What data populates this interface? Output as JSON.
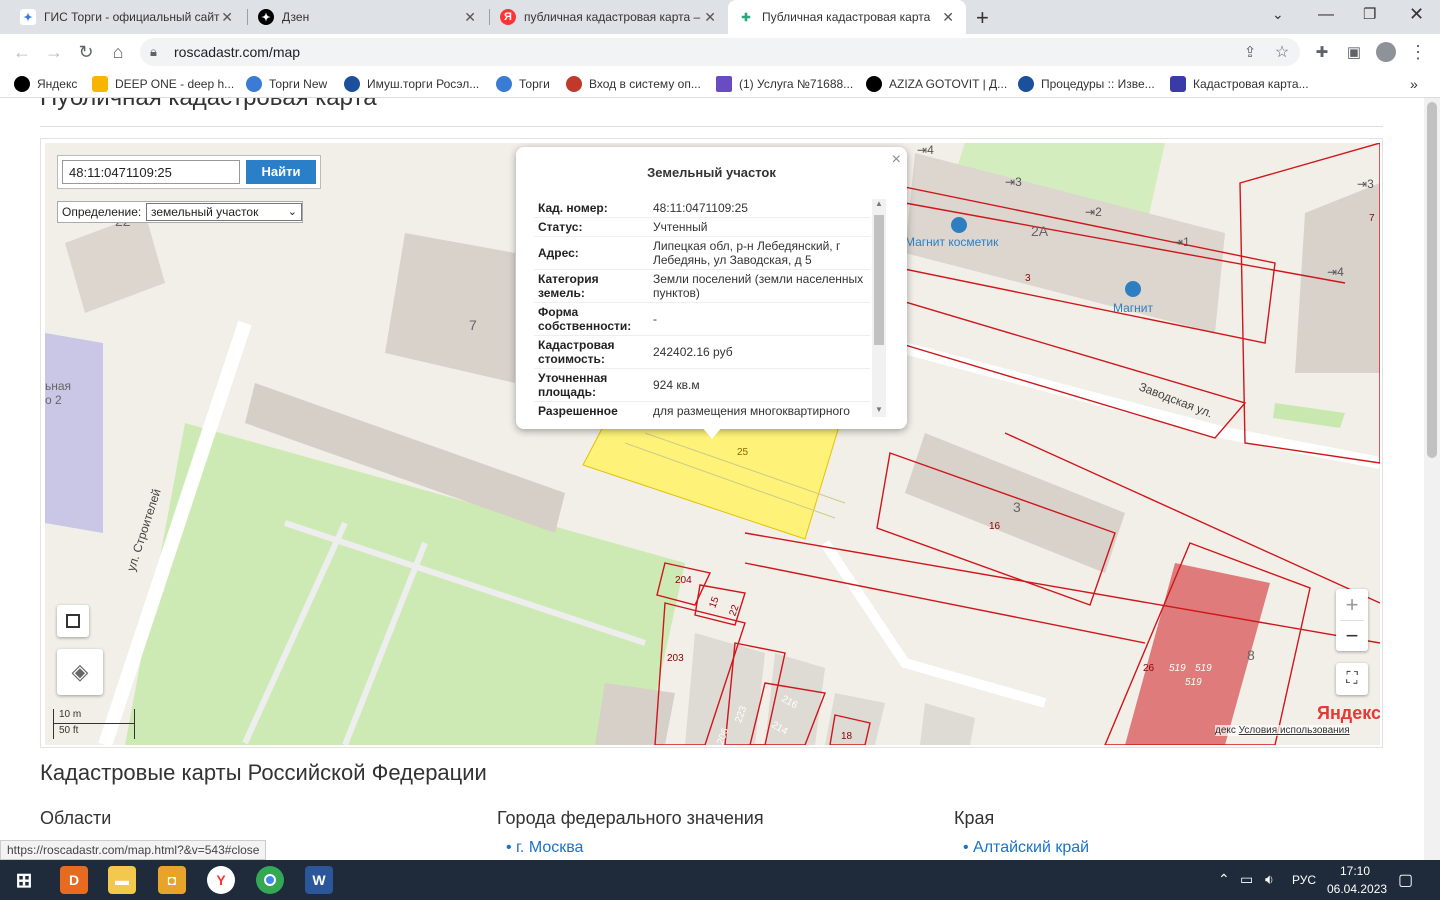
{
  "tabs": [
    {
      "label": "ГИС Торги - официальный сайт",
      "icon": "gis-torgi-icon",
      "color": "#3a7bd5"
    },
    {
      "label": "Дзен",
      "icon": "dzen-icon",
      "color": "#000000"
    },
    {
      "label": "публичная кадастровая карта –",
      "icon": "yandex-icon",
      "color": "#f33"
    },
    {
      "label": "Публичная кадастровая карта",
      "icon": "map-icon",
      "color": "#2aa876"
    }
  ],
  "url": "roscadastr.com/map",
  "bookmarks": [
    {
      "label": "Яндекс",
      "color": "#000000"
    },
    {
      "label": "DEEP ONE - deep h...",
      "color": "#f7b500"
    },
    {
      "label": "Торги New",
      "color": "#3a7bd5"
    },
    {
      "label": "Имуш.торги Росэл...",
      "color": "#1c4f9c"
    },
    {
      "label": "Торги",
      "color": "#3a7bd5"
    },
    {
      "label": "Вход в систему оп...",
      "color": "#c0392b"
    },
    {
      "label": "(1) Услуга №71688...",
      "color": "#6a4cc2"
    },
    {
      "label": "AZIZA GOTOVIT | Д...",
      "color": "#000000"
    },
    {
      "label": "Процедуры :: Изве...",
      "color": "#1c4f9c"
    },
    {
      "label": "Кадастровая карта...",
      "color": "#3a3aa8"
    }
  ],
  "page": {
    "title": "Публичная кадастровая карта",
    "search_value": "48:11:0471109:25",
    "find_label": "Найти",
    "definition_label": "Определение:",
    "definition_value": "земельный участок"
  },
  "popup": {
    "title": "Земельный участок",
    "rows": [
      {
        "k": "Кад. номер:",
        "v": "48:11:0471109:25"
      },
      {
        "k": "Статус:",
        "v": "Учтенный"
      },
      {
        "k": "Адрес:",
        "v": "Липецкая обл, р-н Лебедянский, г Лебедянь, ул Заводская, д 5"
      },
      {
        "k": "Категория земель:",
        "v": "Земли поселений (земли населенных пунктов)"
      },
      {
        "k": "Форма собственности:",
        "v": "-"
      },
      {
        "k": "Кадастровая стоимость:",
        "v": "242402.16 руб"
      },
      {
        "k": "Уточненная площадь:",
        "v": "924 кв.м"
      },
      {
        "k": "Разрешенное",
        "v": "для размещения многоквартирного"
      }
    ]
  },
  "map": {
    "labels": {
      "magnit_kosmetik": "Магнит косметик",
      "magnit": "Магнит",
      "zavodskaya": "Заводская ул.",
      "stroiteley": "ул. Строителей",
      "b2a": "2А",
      "b7": "7",
      "b3": "3",
      "b8": "8",
      "b22": "22",
      "b4": "4",
      "parcel25": "25",
      "p16": "16",
      "p204": "204",
      "p15": "15",
      "p22": "22",
      "p203": "203",
      "p26": "26",
      "p519a": "519",
      "p519b": "519",
      "p519c": "519",
      "p223": "223",
      "p216": "216",
      "p214": "214",
      "p206": "206",
      "p18": "18",
      "p3": "3",
      "p7": "7",
      "pn2": "2",
      "pn3": "3",
      "pn1": "1",
      "pn4": "4",
      "pn4b": "4",
      "pn3b": "3",
      "school": "ьная\nо 2",
      "yandex": "Яндекс",
      "terms": "Условия использования",
      "terms_prefix": "декс",
      "scale_m": "10 m",
      "scale_ft": "50 ft"
    },
    "zoom_in": "+",
    "zoom_out": "−"
  },
  "below": {
    "title": "Кадастровые карты Российской Федерации",
    "col1": "Области",
    "col2": "Города федерального значения",
    "col3": "Края",
    "link2": "г. Москва",
    "link3": "Алтайский край"
  },
  "status_url": "https://roscadastr.com/map.html?&v=543#close",
  "tray": {
    "lang": "РУС",
    "time": "17:10",
    "date": "06.04.2023"
  }
}
